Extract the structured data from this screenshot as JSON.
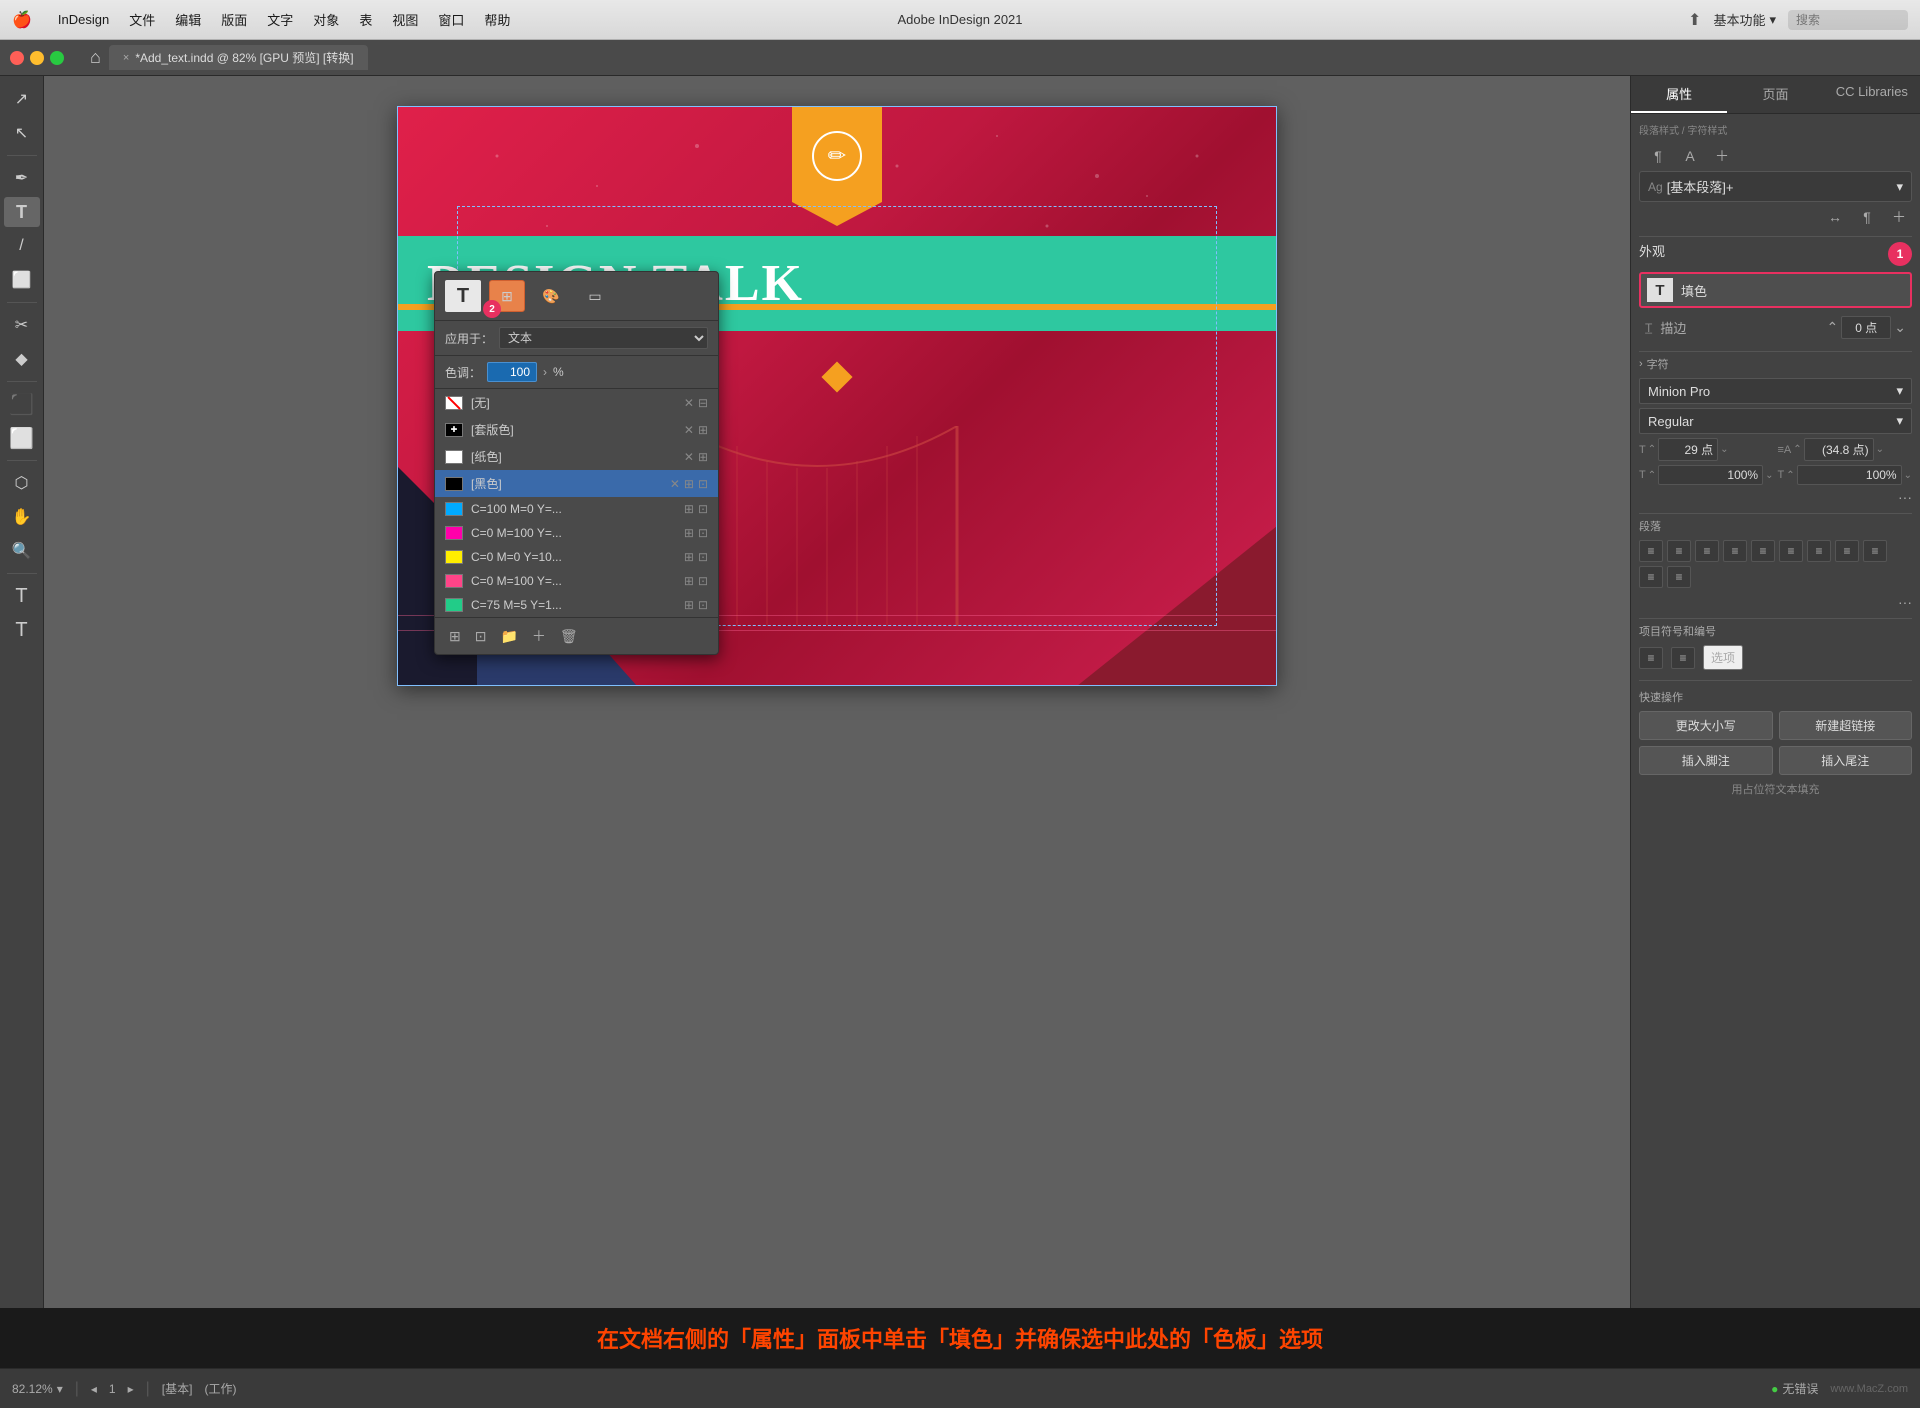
{
  "menubar": {
    "apple": "🍎",
    "app": "InDesign",
    "menus": [
      "文件",
      "编辑",
      "版面",
      "文字",
      "对象",
      "表",
      "视图",
      "窗口",
      "帮助"
    ],
    "title": "Adobe InDesign 2021",
    "workspace": "基本功能",
    "search_placeholder": "搜索"
  },
  "tab": {
    "close": "×",
    "name": "*Add_text.indd @ 82% [GPU 预览] [转换]"
  },
  "left_toolbar": {
    "tools": [
      "↗",
      "↖",
      "↕",
      "✏",
      "T",
      "/",
      "✒",
      "◆",
      "✂",
      "⬡",
      "⬜",
      "☰",
      "✦"
    ]
  },
  "swatches_panel": {
    "apply_to_label": "应用于：",
    "apply_to_value": "文本",
    "tint_label": "色调：",
    "tint_value": "100",
    "tint_pct": "%",
    "swatches": [
      {
        "name": "[无]",
        "color": "none",
        "active": false
      },
      {
        "name": "[套版色]",
        "color": "#000000",
        "active": false
      },
      {
        "name": "[纸色]",
        "color": "#ffffff",
        "active": false
      },
      {
        "name": "[黑色]",
        "color": "#000000",
        "active": true
      },
      {
        "name": "C=100 M=0 Y=...",
        "color": "#00aaff",
        "active": false
      },
      {
        "name": "C=0 M=100 Y=...",
        "color": "#ff00aa",
        "active": false
      },
      {
        "name": "C=0 M=0 Y=10...",
        "color": "#ffff00",
        "active": false
      },
      {
        "name": "C=0 M=100 Y=...",
        "color": "#ff44aa",
        "active": false
      },
      {
        "name": "C=75 M=5 Y=1...",
        "color": "#22cc88",
        "active": false
      }
    ]
  },
  "right_panel": {
    "tabs": [
      "属性",
      "页面",
      "CC Libraries"
    ],
    "active_tab": "属性",
    "style_label": "[基本段落]+",
    "appearance": {
      "label": "外观",
      "fill_label": "填色",
      "stroke_label": "描边",
      "stroke_value": "0 点"
    },
    "character": {
      "label": "字符",
      "font": "Minion Pro",
      "style": "Regular",
      "size": "29 点",
      "leading": "(34.8 点)",
      "tracking": "100%",
      "scaling": "100%"
    },
    "paragraph": {
      "label": "段落",
      "aligns": [
        "≡",
        "≡",
        "≡",
        "≡",
        "≡",
        "≡",
        "≡",
        "≡",
        "≡",
        "≡",
        "≡"
      ]
    },
    "list": {
      "label": "项目符号和编号",
      "options_btn": "选项"
    },
    "quick_actions": {
      "label": "快速操作",
      "btn1": "更改大小写",
      "btn2": "新建超链接",
      "btn3": "插入脚注",
      "btn4": "插入尾注"
    }
  },
  "instruction": {
    "text": "在文档右侧的「属性」面板中单击「填色」并确保选中此处的「色板」选项"
  },
  "status_bar": {
    "zoom": "82.12%",
    "page": "1",
    "base": "[基本]",
    "mode": "(工作)",
    "status": "无错误"
  },
  "watermark": "www.MacZ.com",
  "badges": {
    "badge1": "1",
    "badge2": "2"
  },
  "design": {
    "title": "DESIGN TALK"
  }
}
